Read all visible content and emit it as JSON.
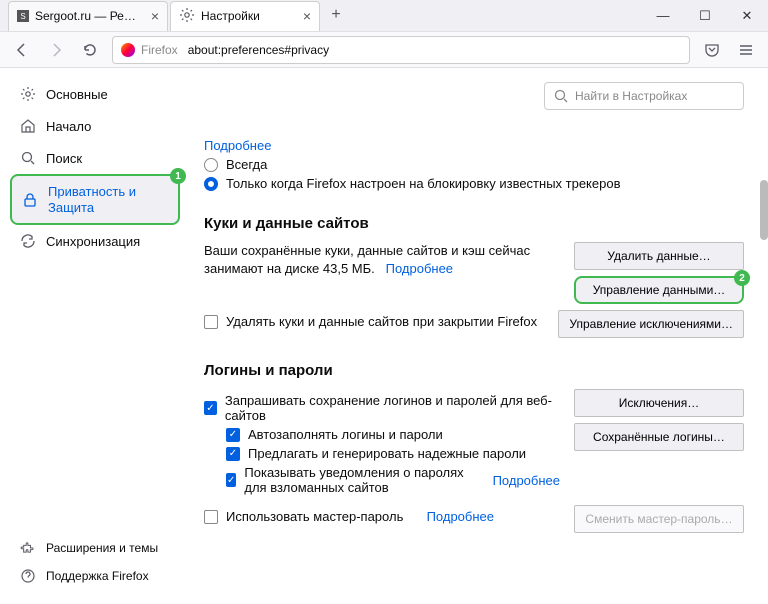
{
  "tabs": [
    {
      "title": "Sergoot.ru — Решение ваших",
      "favicon": "S"
    },
    {
      "title": "Настройки",
      "favicon": "gear"
    }
  ],
  "url": {
    "brand": "Firefox",
    "path": "about:preferences#privacy"
  },
  "search_placeholder": "Найти в Настройках",
  "sidebar": {
    "items": [
      {
        "label": "Основные"
      },
      {
        "label": "Начало"
      },
      {
        "label": "Поиск"
      },
      {
        "label": "Приватность и Защита"
      },
      {
        "label": "Синхронизация"
      }
    ],
    "bottom": [
      {
        "label": "Расширения и темы"
      },
      {
        "label": "Поддержка Firefox"
      }
    ]
  },
  "details_link": "Подробнее",
  "dnt": {
    "always": "Всегда",
    "only_block": "Только когда Firefox настроен на блокировку известных трекеров"
  },
  "cookies": {
    "heading": "Куки и данные сайтов",
    "desc_prefix": "Ваши сохранённые куки, данные сайтов и кэш сейчас занимают на диске ",
    "size": "43,5 МБ.",
    "more": "Подробнее",
    "delete_on_close": "Удалять куки и данные сайтов при закрытии Firefox",
    "btn_clear": "Удалить данные…",
    "btn_manage": "Управление данными…",
    "btn_exceptions": "Управление исключениями…"
  },
  "logins": {
    "heading": "Логины и пароли",
    "ask_save": "Запрашивать сохранение логинов и паролей для веб-сайтов",
    "autofill": "Автозаполнять логины и пароли",
    "suggest": "Предлагать и генерировать надежные пароли",
    "alerts": "Показывать уведомления о паролях для взломанных сайтов",
    "more": "Подробнее",
    "master": "Использовать мастер-пароль",
    "master_more": "Подробнее",
    "btn_exceptions": "Исключения…",
    "btn_saved": "Сохранённые логины…",
    "btn_change_master": "Сменить мастер-пароль…"
  },
  "annotations": {
    "one": "1",
    "two": "2"
  }
}
